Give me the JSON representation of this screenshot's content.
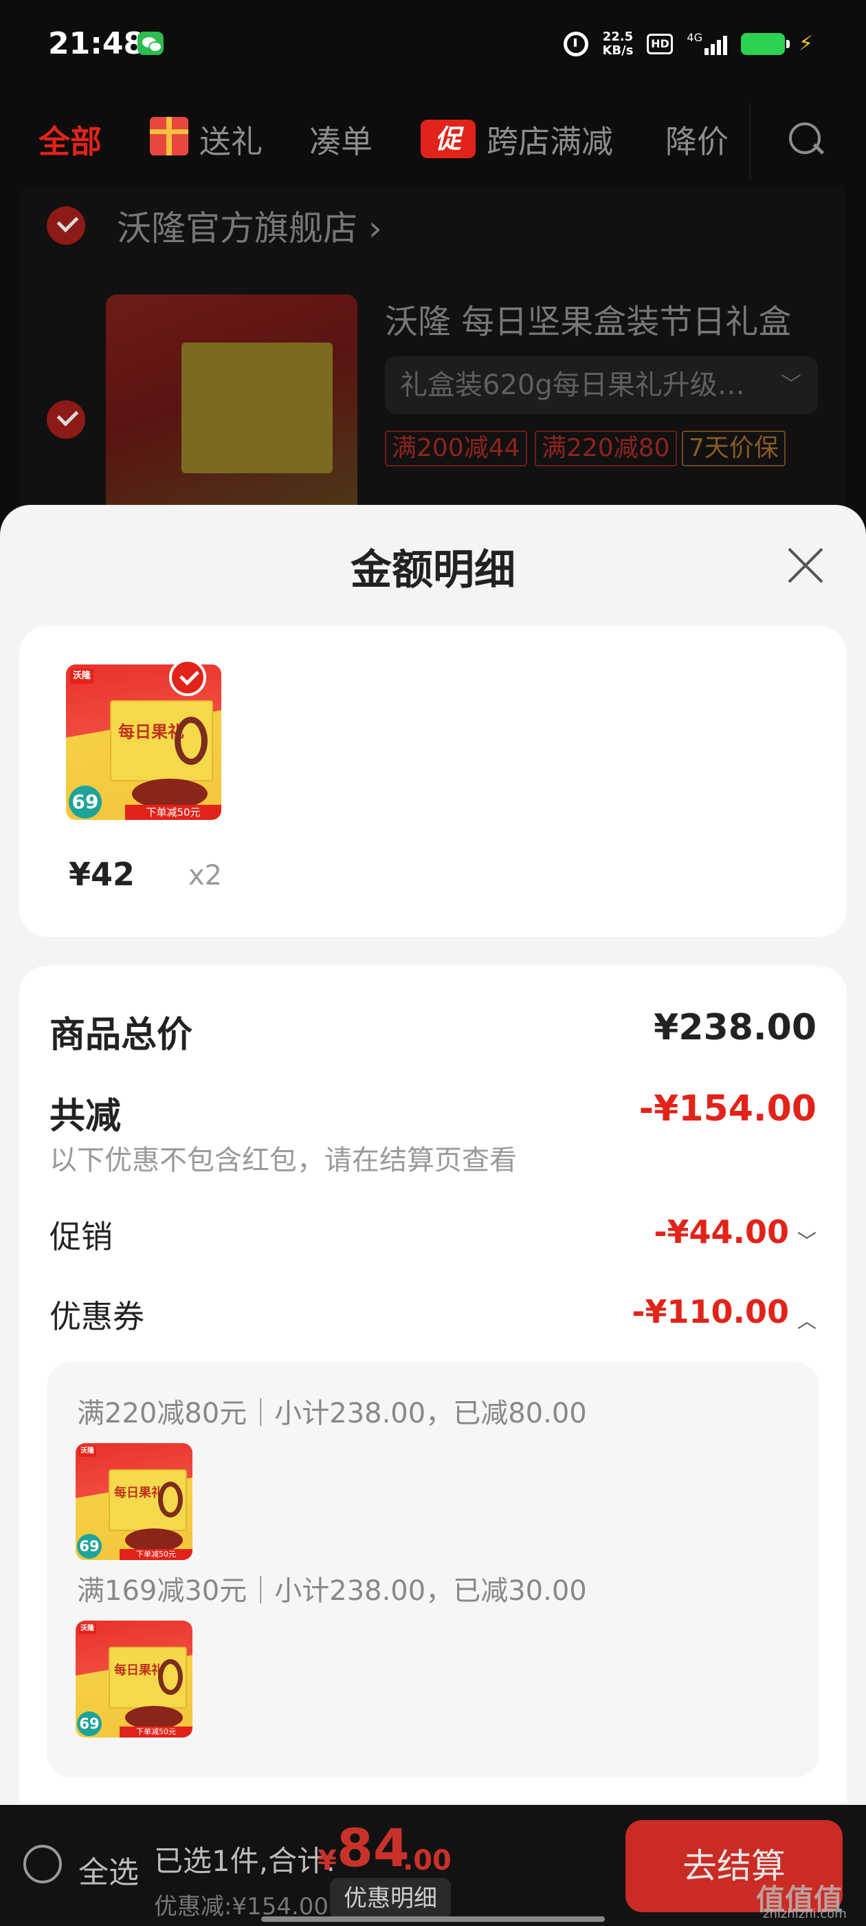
{
  "status_bar": {
    "time": "21:48",
    "net_speed_top": "22.5",
    "net_speed_bottom": "KB/s",
    "hd_label": "HD",
    "network_label": "4G",
    "battery_color": "#2bd150"
  },
  "tabs": {
    "all": "全部",
    "gift": "送礼",
    "bundle": "凑单",
    "promo_badge": "促",
    "cross_store": "跨店满减",
    "price_drop": "降价",
    "active_color": "#e2231a"
  },
  "store": {
    "name": "沃隆官方旗舰店",
    "name_chevron": "›",
    "product_title": "沃隆 每日坚果盒装节日礼盒",
    "spec": "礼盒装620g每日果礼升级…",
    "tags": [
      "满200减44",
      "满220减80",
      "7天价保"
    ]
  },
  "sheet": {
    "title": "金额明细",
    "item": {
      "price": "¥42",
      "qty": "x2",
      "thumb_brand": "沃隆",
      "thumb_badge": "69",
      "thumb_strip": "下单减50元",
      "thumb_text": "每日果礼"
    },
    "summary": {
      "total_label": "商品总价",
      "total_value": "¥238.00",
      "reduce_label": "共减",
      "reduce_value": "-¥154.00",
      "reduce_note": "以下优惠不包含红包，请在结算页查看",
      "promo_label": "促销",
      "promo_value": "-¥44.00",
      "coupon_label": "优惠券",
      "coupon_value": "-¥110.00"
    },
    "coupons": [
      {
        "text": "满220减80元｜小计238.00，已减80.00"
      },
      {
        "text": "满169减30元｜小计238.00，已减30.00"
      }
    ],
    "accent_red": "#e2231a"
  },
  "bottom_bar": {
    "select_all": "全选",
    "selected_text": "已选1件,合计:",
    "total_yen": "¥",
    "total_int": "84",
    "total_dec": ".00",
    "discount_text": "优惠减:¥154.00",
    "detail_button": "优惠明细",
    "checkout": "去结算"
  },
  "watermark": {
    "main": "值值值",
    "sub": "zhizhizhi.com"
  }
}
